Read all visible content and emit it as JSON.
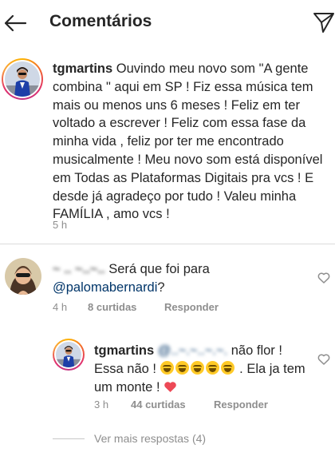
{
  "header": {
    "title": "Comentários",
    "back_icon": "arrow-left-icon",
    "send_icon": "paper-plane-icon"
  },
  "caption": {
    "username": "tgmartins",
    "text": "Ouvindo meu novo som \"A gente combina \" aqui em SP ! Fiz essa música tem mais ou menos uns 6 meses ! Feliz em ter voltado a escrever ! Feliz com essa fase da minha vida , feliz por ter me encontrado musicalmente ! Meu novo som está disponível em Todas as Plataformas Digitais pra vcs ! E desde já agradeço por tudo ! Valeu minha  FAMÍLIA , amo vcs !",
    "time": "5 h"
  },
  "comment": {
    "username": "~ .. ~..~..",
    "text": "Será que foi para",
    "mention": "@palomabernardi",
    "text_after": "?",
    "time": "4 h",
    "likes": "8 curtidas",
    "reply_label": "Responder"
  },
  "reply": {
    "username": "tgmartins",
    "mention": "@..~.~..~.~.",
    "text_before_emoji": " não flor ! Essa não ! ",
    "text_after_emoji": " . Ela ja tem um monte ! ",
    "emoji_count": 5,
    "time": "3 h",
    "likes": "44 curtidas",
    "reply_label": "Responder"
  },
  "more_replies": "Ver mais respostas (4)",
  "colors": {
    "text": "#262626",
    "muted": "#8e8e8e",
    "mention": "#003569",
    "heart_red": "#ed4956"
  }
}
